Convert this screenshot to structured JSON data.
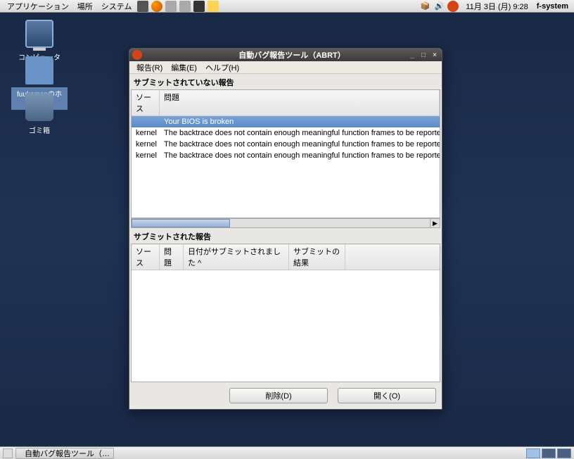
{
  "top_panel": {
    "menus": [
      "アプリケーション",
      "場所",
      "システム"
    ],
    "clock": "11月  3日 (月)   9:28",
    "hostname": "f-system"
  },
  "desktop_icons": {
    "computer": "コンピュータ",
    "home": "fuukemonのホーム",
    "trash": "ゴミ箱"
  },
  "window": {
    "title": "自動バグ報告ツール（ABRT）",
    "menu": {
      "report": "報告(R)",
      "edit": "編集(E)",
      "help": "ヘルプ(H)"
    },
    "unsubmitted_label": "サブミットされていない報告",
    "submitted_label": "サブミットされた報告",
    "columns": {
      "source": "ソース",
      "problem": "問題",
      "date_submitted": "日付がサブミットされました ^",
      "submit_result": "サブミットの結果"
    },
    "unsubmitted_rows": [
      {
        "source": "",
        "problem": "Your BIOS is broken"
      },
      {
        "source": "kernel",
        "problem": "The backtrace does not contain enough meaningful function frames to be reported. It is anno"
      },
      {
        "source": "kernel",
        "problem": "The backtrace does not contain enough meaningful function frames to be reported. It is anno"
      },
      {
        "source": "kernel",
        "problem": "The backtrace does not contain enough meaningful function frames to be reported. It is anno"
      }
    ],
    "buttons": {
      "delete": "削除(D)",
      "open": "開く(O)"
    }
  },
  "taskbar": {
    "task": "自動バグ報告ツール（…"
  }
}
